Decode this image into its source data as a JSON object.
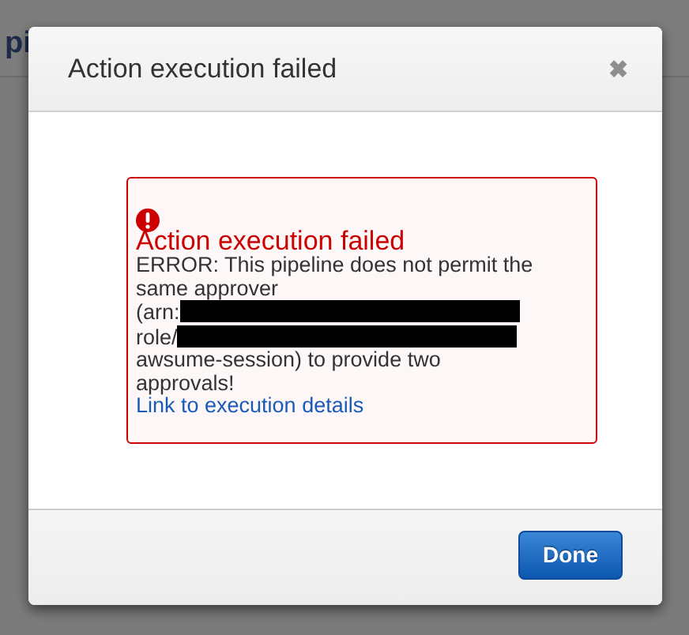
{
  "background_page": {
    "heading_fragment": "pi"
  },
  "dialog": {
    "title": "Action execution failed",
    "close_label": "✖",
    "alert": {
      "kind": "error",
      "title": "Action execution failed",
      "message": [
        {
          "kind": "text",
          "text": "ERROR: This pipeline does not permit the same approver (arn:"
        },
        {
          "kind": "redacted"
        },
        {
          "kind": "text",
          "text": "role/"
        },
        {
          "kind": "redacted"
        },
        {
          "kind": "text",
          "text": "awsume-session) to provide two approvals!"
        }
      ],
      "link": "Link to execution details"
    },
    "buttons": [
      {
        "label": "Done",
        "primary": true
      }
    ]
  }
}
